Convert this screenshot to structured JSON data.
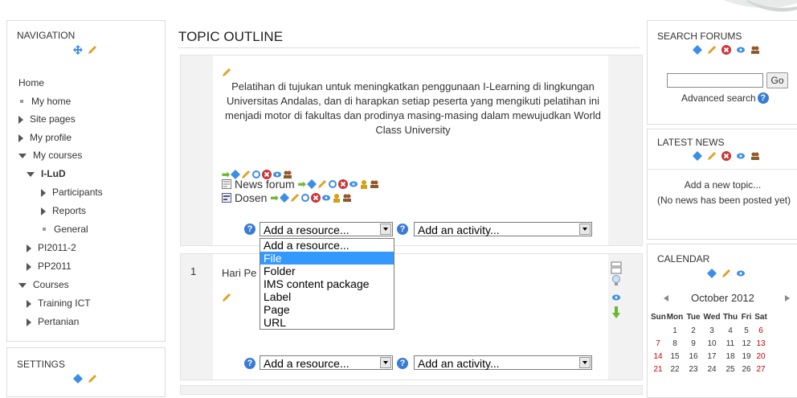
{
  "navigation": {
    "title": "NAVIGATION",
    "home": "Home",
    "items": {
      "my_home": "My home",
      "site_pages": "Site pages",
      "my_profile": "My profile",
      "my_courses": "My courses",
      "ilud": "I-LuD",
      "participants": "Participants",
      "reports": "Reports",
      "general": "General",
      "pi2011": "PI2011-2",
      "pp2011": "PP2011",
      "courses": "Courses",
      "training_ict": "Training ICT",
      "pertanian": "Pertanian"
    }
  },
  "settings": {
    "title": "SETTINGS"
  },
  "main": {
    "title": "TOPIC OUTLINE",
    "summary": "Pelatihan di tujukan untuk meningkatkan penggunaan I-Learning di lingkungan Universitas Andalas, dan di harapkan setiap peserta yang mengikuti pelatihan ini menjadi motor di fakultas dan prodinya masing-masing dalam mewujudkan World Class University",
    "news_forum": "News forum",
    "dosen": "Dosen",
    "add_resource": "Add a resource...",
    "add_activity": "Add an activity...",
    "dropdown_options": [
      "Add a resource...",
      "File",
      "Folder",
      "IMS content package",
      "Label",
      "Page",
      "URL"
    ],
    "dropdown_selected": "File",
    "section1_number": "1",
    "section1_title": "Hari Pe"
  },
  "search_forums": {
    "title": "SEARCH FORUMS",
    "go": "Go",
    "advanced": "Advanced search"
  },
  "latest_news": {
    "title": "LATEST NEWS",
    "add_topic": "Add a new topic...",
    "no_news": "(No news has been posted yet)"
  },
  "calendar": {
    "title": "CALENDAR",
    "month": "October 2012",
    "days": [
      "Sun",
      "Mon",
      "Tue",
      "Wed",
      "Thu",
      "Fri",
      "Sat"
    ],
    "weeks": [
      [
        "",
        "1",
        "2",
        "3",
        "4",
        "5",
        "6"
      ],
      [
        "7",
        "8",
        "9",
        "10",
        "11",
        "12",
        "13"
      ],
      [
        "14",
        "15",
        "16",
        "17",
        "18",
        "19",
        "20"
      ],
      [
        "21",
        "22",
        "23",
        "24",
        "25",
        "26",
        "27"
      ]
    ]
  },
  "colors": {
    "move": "#3a8ee6",
    "edit": "#e0a020",
    "delete": "#cc3333",
    "arrow_green": "#6bb82b",
    "selected": "#3399ff"
  }
}
